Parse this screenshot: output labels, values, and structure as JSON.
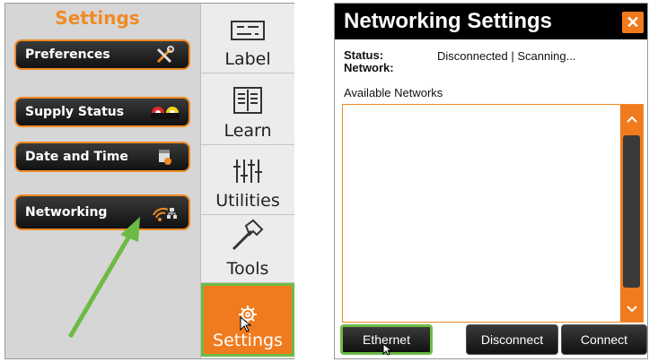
{
  "left": {
    "title": "Settings",
    "menu": [
      {
        "label": "Preferences",
        "icon": "tools-icon"
      },
      {
        "label": "Supply Status",
        "icon": "tape-rolls-icon"
      },
      {
        "label": "Date and Time",
        "icon": "calendar-clock-icon"
      },
      {
        "label": "Networking",
        "icon": "wifi-network-icon"
      }
    ],
    "nav": [
      {
        "label": "Label",
        "icon": "label-icon"
      },
      {
        "label": "Learn",
        "icon": "book-icon"
      },
      {
        "label": "Utilities",
        "icon": "sliders-icon"
      },
      {
        "label": "Tools",
        "icon": "hammer-icon"
      },
      {
        "label": "Settings",
        "icon": "gear-icon"
      }
    ]
  },
  "dialog": {
    "title": "Networking Settings",
    "close": "✕",
    "status_label": "Status:",
    "network_label": "Network:",
    "status_value": "Disconnected | Scanning...",
    "available_label": "Available Networks",
    "buttons": {
      "ethernet": "Ethernet",
      "disconnect": "Disconnect",
      "connect": "Connect"
    }
  },
  "colors": {
    "accent": "#f07b1e",
    "highlight": "#6dbb45"
  }
}
